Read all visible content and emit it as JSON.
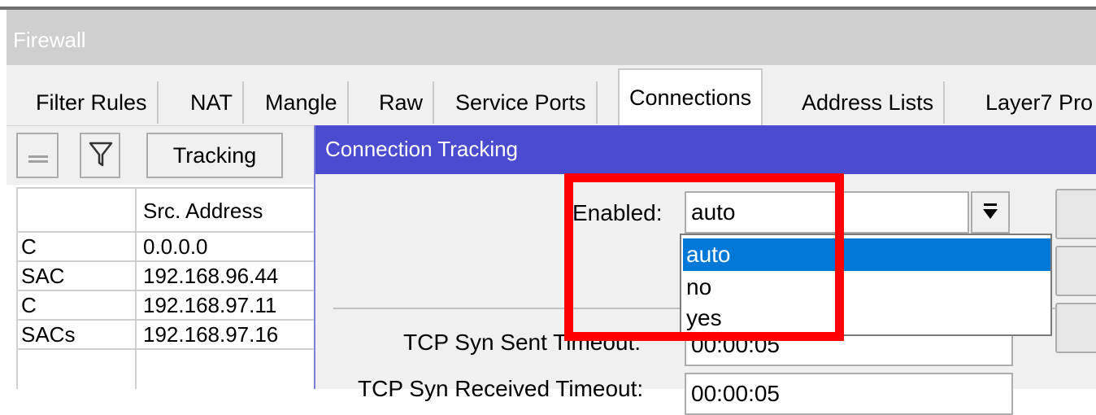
{
  "window": {
    "title": "Firewall"
  },
  "tabs": [
    {
      "label": "Filter Rules"
    },
    {
      "label": "NAT"
    },
    {
      "label": "Mangle"
    },
    {
      "label": "Raw"
    },
    {
      "label": "Service Ports"
    },
    {
      "label": "Connections",
      "active": true
    },
    {
      "label": "Address Lists"
    },
    {
      "label": "Layer7 Pro"
    }
  ],
  "toolbar": {
    "tracking_label": "Tracking"
  },
  "table": {
    "columns": [
      "",
      "Src. Address"
    ],
    "rows": [
      [
        "C",
        "0.0.0.0"
      ],
      [
        "SAC",
        "192.168.96.44"
      ],
      [
        "C",
        "192.168.97.11"
      ],
      [
        "SACs",
        "192.168.97.16"
      ]
    ]
  },
  "dialog": {
    "title": "Connection Tracking",
    "enabled_label": "Enabled:",
    "enabled_value": "auto",
    "options": [
      "auto",
      "no",
      "yes"
    ],
    "selected_option": "auto",
    "tcp_syn_sent_label": "TCP Syn Sent Timeout:",
    "tcp_syn_sent_value": "00:00:05",
    "tcp_syn_received_label": "TCP Syn Received Timeout:",
    "tcp_syn_received_value": "00:00:05"
  },
  "colors": {
    "dialog_title_bg": "#4b4bcf",
    "selection": "#0078d7",
    "highlight_box": "#ff0000"
  }
}
